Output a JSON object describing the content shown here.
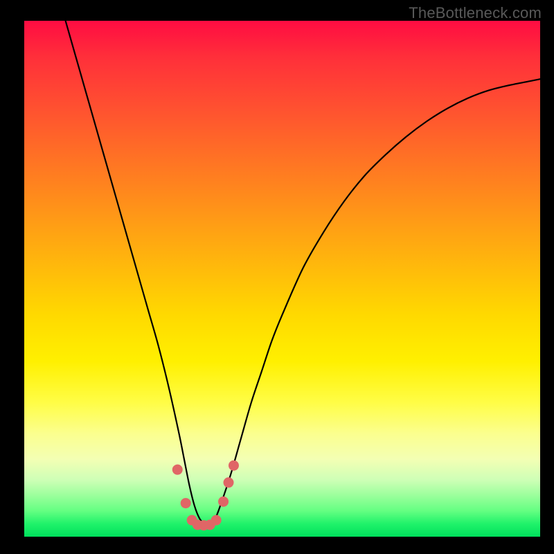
{
  "watermark": "TheBottleneck.com",
  "chart_data": {
    "type": "line",
    "title": "",
    "xlabel": "",
    "ylabel": "",
    "xlim": [
      0,
      100
    ],
    "ylim": [
      0,
      100
    ],
    "grid": false,
    "legend": false,
    "series": [
      {
        "name": "bottleneck-curve",
        "color": "#000000",
        "x": [
          8,
          10,
          12,
          14,
          16,
          18,
          20,
          22,
          24,
          26,
          28,
          30,
          31,
          32,
          33,
          34,
          35,
          36,
          37,
          38,
          40,
          42,
          44,
          46,
          48,
          50,
          54,
          58,
          62,
          66,
          70,
          74,
          78,
          82,
          86,
          90,
          94,
          98,
          100
        ],
        "y": [
          100,
          93,
          86,
          79,
          72,
          65,
          58,
          51,
          44,
          37,
          29,
          20,
          15,
          10,
          6,
          3.5,
          2.5,
          2.5,
          3.5,
          6,
          12,
          19,
          26,
          32,
          38,
          43,
          52,
          59,
          65,
          70,
          74,
          77.5,
          80.5,
          83,
          85,
          86.5,
          87.5,
          88.3,
          88.7
        ]
      }
    ],
    "markers": [
      {
        "name": "dot",
        "shape": "circle",
        "color": "#e06666",
        "x": 29.7,
        "y": 13
      },
      {
        "name": "dot",
        "shape": "circle",
        "color": "#e06666",
        "x": 31.3,
        "y": 6.5
      },
      {
        "name": "dot",
        "shape": "circle",
        "color": "#e06666",
        "x": 32.5,
        "y": 3.2
      },
      {
        "name": "dot",
        "shape": "circle",
        "color": "#e06666",
        "x": 33.6,
        "y": 2.3
      },
      {
        "name": "dot",
        "shape": "circle",
        "color": "#e06666",
        "x": 34.8,
        "y": 2.2
      },
      {
        "name": "dot",
        "shape": "circle",
        "color": "#e06666",
        "x": 36.0,
        "y": 2.3
      },
      {
        "name": "dot",
        "shape": "circle",
        "color": "#e06666",
        "x": 37.2,
        "y": 3.2
      },
      {
        "name": "dot",
        "shape": "circle",
        "color": "#e06666",
        "x": 38.6,
        "y": 6.8
      },
      {
        "name": "dot",
        "shape": "circle",
        "color": "#e06666",
        "x": 39.6,
        "y": 10.5
      },
      {
        "name": "dot",
        "shape": "circle",
        "color": "#e06666",
        "x": 40.6,
        "y": 13.8
      }
    ],
    "background_gradient": {
      "direction": "top-to-bottom",
      "stops": [
        {
          "pos": 0.0,
          "color": "#ff0c42"
        },
        {
          "pos": 0.5,
          "color": "#ffc400"
        },
        {
          "pos": 0.8,
          "color": "#fbff8e"
        },
        {
          "pos": 1.0,
          "color": "#00e05c"
        }
      ]
    }
  }
}
